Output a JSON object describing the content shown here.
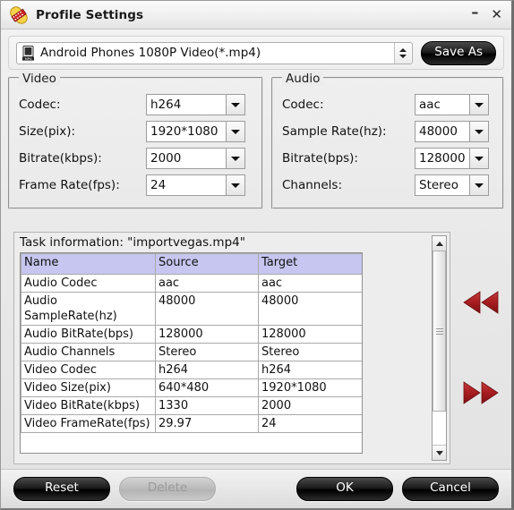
{
  "window": {
    "title": "Profile Settings",
    "icon": "profile-settings-icon",
    "minimize_label": "–",
    "close_label": "✕"
  },
  "profile": {
    "icon": "mp4-device-icon",
    "selected": "Android Phones 1080P Video(*.mp4)",
    "spinner_icon": "up-down-spinner-icon",
    "save_as_label": "Save As"
  },
  "video_group": {
    "title": "Video",
    "fields": [
      {
        "label": "Codec:",
        "value": "h264"
      },
      {
        "label": "Size(pix):",
        "value": "1920*1080"
      },
      {
        "label": "Bitrate(kbps):",
        "value": "2000"
      },
      {
        "label": "Frame Rate(fps):",
        "value": "24"
      }
    ]
  },
  "audio_group": {
    "title": "Audio",
    "fields": [
      {
        "label": "Codec:",
        "value": "aac"
      },
      {
        "label": "Sample Rate(hz):",
        "value": "48000"
      },
      {
        "label": "Bitrate(bps):",
        "value": "128000"
      },
      {
        "label": "Channels:",
        "value": "Stereo"
      }
    ]
  },
  "task_info": {
    "caption": "Task information: \"importvegas.mp4\"",
    "columns": [
      "Name",
      "Source",
      "Target"
    ],
    "header_color": "#c6c6f0",
    "rows": [
      {
        "name": "Audio Codec",
        "source": "aac",
        "target": "aac"
      },
      {
        "name": "Audio SampleRate(hz)",
        "source": "48000",
        "target": "48000"
      },
      {
        "name": "Audio BitRate(bps)",
        "source": "128000",
        "target": "128000"
      },
      {
        "name": "Audio Channels",
        "source": "Stereo",
        "target": "Stereo"
      },
      {
        "name": "Video Codec",
        "source": "h264",
        "target": "h264"
      },
      {
        "name": "Video Size(pix)",
        "source": "640*480",
        "target": "1920*1080"
      },
      {
        "name": "Video BitRate(kbps)",
        "source": "1330",
        "target": "2000"
      },
      {
        "name": "Video FrameRate(fps)",
        "source": "29.97",
        "target": "24"
      }
    ],
    "scrollbar": {
      "up_icon": "scroll-up-arrow-icon",
      "down_icon": "scroll-down-arrow-icon",
      "thumb_icon": "scrollbar-thumb-grip"
    }
  },
  "nav": {
    "prev_icon": "rewind-double-arrow-icon",
    "next_icon": "forward-double-arrow-icon",
    "accent_color": "#a91f22"
  },
  "footer": {
    "reset_label": "Reset",
    "delete_label": "Delete",
    "delete_disabled": true,
    "ok_label": "OK",
    "cancel_label": "Cancel"
  }
}
